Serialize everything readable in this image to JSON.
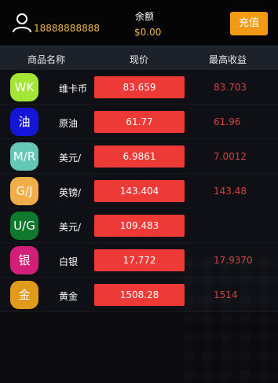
{
  "header": {
    "phone": "18888888888",
    "balance_label": "余额",
    "balance_value": "$0.00",
    "recharge_label": "充值",
    "avatar_icon": "user-icon"
  },
  "table": {
    "headers": [
      "商品名称",
      "现价",
      "最高收益"
    ],
    "rows": [
      {
        "badge": "WK",
        "badge_color": "#a3e635",
        "name": "维卡币",
        "price": "83.659",
        "max": "83.703"
      },
      {
        "badge": "油",
        "badge_color": "#1515d6",
        "name": "原油",
        "price": "61.77",
        "max": "61.96"
      },
      {
        "badge": "M/R",
        "badge_color": "#65c8b6",
        "name": "美元/",
        "price": "6.9861",
        "max": "7.0012"
      },
      {
        "badge": "G/J",
        "badge_color": "#f0ad48",
        "name": "英镑/",
        "price": "143.404",
        "max": "143.48"
      },
      {
        "badge": "U/G",
        "badge_color": "#0f7a2d",
        "name": "美元/",
        "price": "109.483",
        "max": ""
      },
      {
        "badge": "银",
        "badge_color": "#d41f7a",
        "name": "白银",
        "price": "17.772",
        "max": "17.9370"
      },
      {
        "badge": "金",
        "badge_color": "#e09a1c",
        "name": "黄金",
        "price": "1508.28",
        "max": "1514"
      }
    ]
  },
  "colors": {
    "accent_orange": "#f29a13",
    "price_red": "#ee3a37",
    "max_red": "#d24242",
    "header_bg": "#1d2129",
    "row_bg": "#0f1015"
  }
}
